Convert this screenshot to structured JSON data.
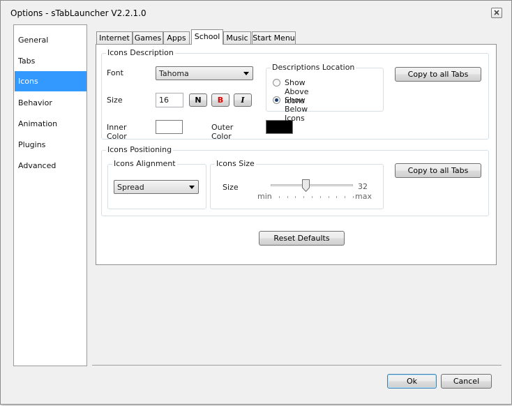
{
  "window": {
    "title": "Options - sTabLauncher V2.2.1.0",
    "close_icon": "close-icon"
  },
  "sidebar": {
    "items": [
      {
        "label": "General"
      },
      {
        "label": "Tabs"
      },
      {
        "label": "Icons",
        "selected": true
      },
      {
        "label": "Behavior"
      },
      {
        "label": "Animation"
      },
      {
        "label": "Plugins"
      },
      {
        "label": "Advanced"
      }
    ]
  },
  "tabs": [
    {
      "label": "Internet"
    },
    {
      "label": "Games"
    },
    {
      "label": "Apps"
    },
    {
      "label": "School",
      "active": true
    },
    {
      "label": "Music"
    },
    {
      "label": "Start Menu"
    }
  ],
  "icons_description": {
    "group_label": "Icons Description",
    "font_label": "Font",
    "font_value": "Tahoma",
    "size_label": "Size",
    "size_value": "16",
    "style_buttons": {
      "normal": "N",
      "bold": "B",
      "italic": "I"
    },
    "inner_color_label": "Inner Color",
    "inner_color": "#ffffff",
    "outer_color_label": "Outer Color",
    "outer_color": "#000000",
    "location": {
      "group_label": "Descriptions Location",
      "above_label": "Show Above Icons",
      "below_label": "Show Below Icons",
      "selected": "below"
    },
    "copy_button": "Copy to all Tabs"
  },
  "icons_positioning": {
    "group_label": "Icons Positioning",
    "alignment": {
      "group_label": "Icons Alignment",
      "value": "Spread"
    },
    "size": {
      "group_label": "Icons Size",
      "label": "Size",
      "value": "32",
      "min_label": "min",
      "max_label": "max",
      "fraction": 0.42
    },
    "copy_button": "Copy to all Tabs"
  },
  "reset_button": "Reset Defaults",
  "footer": {
    "ok": "Ok",
    "cancel": "Cancel"
  },
  "colors": {
    "selection": "#3399ff",
    "bold_red": "#e00000"
  }
}
